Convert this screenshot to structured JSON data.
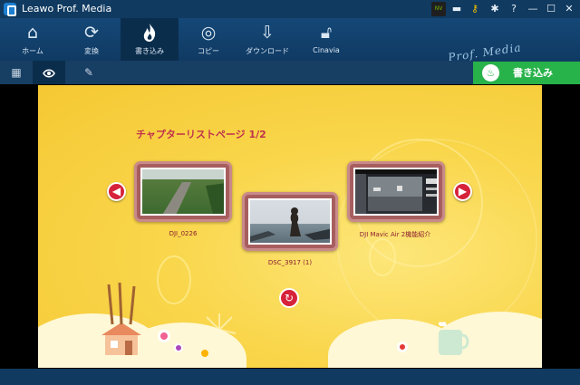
{
  "window": {
    "title": "Leawo Prof. Media",
    "controls": {
      "nvidia": "nvidia-icon",
      "chat": "chat-icon",
      "key": "key-icon",
      "settings": "gear-icon",
      "help": "help-icon",
      "minimize": "minimize-icon",
      "maximize": "maximize-icon",
      "close": "close-icon"
    }
  },
  "nav": {
    "items": [
      {
        "label": "ホーム",
        "icon": "home-icon"
      },
      {
        "label": "変換",
        "icon": "refresh-icon"
      },
      {
        "label": "書き込み",
        "icon": "flame-icon",
        "active": true
      },
      {
        "label": "コピー",
        "icon": "disc-icon"
      },
      {
        "label": "ダウンロード",
        "icon": "download-icon"
      },
      {
        "label": "Cinavia",
        "icon": "cinavia-lock-icon"
      }
    ],
    "brand": "Prof. Media"
  },
  "toolbar": {
    "grid_icon": "grid-icon",
    "preview_icon": "eye-icon",
    "edit_icon": "pencil-icon",
    "burn_label": "書き込み"
  },
  "menu": {
    "title": "チャプターリストページ 1/2",
    "chapters": [
      {
        "label": "DJI_0226"
      },
      {
        "label": "DSC_3917 (1)"
      },
      {
        "label": "DJI Mavic Air 2機能紹介"
      }
    ]
  },
  "colors": {
    "titlebar": "#103a60",
    "nav_active": "#0b2d4c",
    "burn_button": "#28b24a",
    "stage_yellow": "#f9d64b",
    "accent_red": "#d6223a"
  }
}
